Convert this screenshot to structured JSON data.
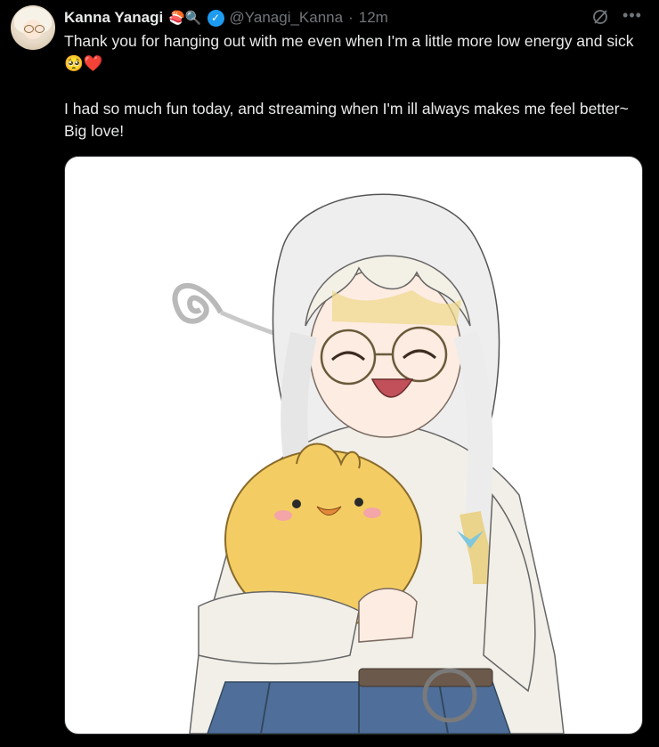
{
  "tweet": {
    "author_name": "Kanna Yanagi",
    "name_emojis": "🍣🔍",
    "handle": "@Yanagi_Kanna",
    "separator": "·",
    "timestamp": "12m",
    "line1": "Thank you for hanging out with me even when I'm a little more low energy and sick",
    "line1_emojis": "🥺❤️",
    "line2": "I had so much fun today, and streaming when I'm ill always makes me feel better~ Big love!"
  },
  "icons": {
    "verified": "verified-badge-icon",
    "grok": "grok-icon",
    "more": "more-icon"
  },
  "colors": {
    "background": "#000000",
    "text": "#e7e9ea",
    "muted": "#71767b",
    "verified": "#1d9bf0",
    "border": "#2f3336"
  }
}
